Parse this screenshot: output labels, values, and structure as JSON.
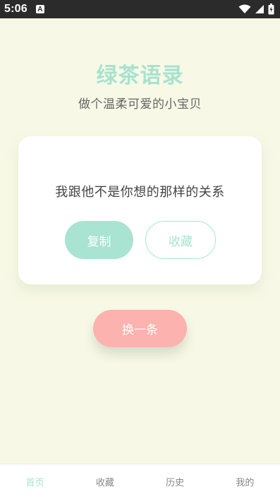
{
  "status_bar": {
    "time": "5:06",
    "badge": "A",
    "icons": [
      "wifi-icon",
      "signal-icon",
      "battery-icon"
    ]
  },
  "header": {
    "title": "绿茶语录",
    "subtitle": "做个温柔可爱的小宝贝"
  },
  "card": {
    "quote": "我跟他不是你想的那样的关系",
    "copy_label": "复制",
    "favorite_label": "收藏"
  },
  "actions": {
    "next_label": "换一条"
  },
  "tab_bar": {
    "tabs": [
      {
        "label": "首页",
        "active": true
      },
      {
        "label": "收藏",
        "active": false
      },
      {
        "label": "历史",
        "active": false
      },
      {
        "label": "我的",
        "active": false
      }
    ]
  },
  "colors": {
    "background": "#f7f9e6",
    "accent_mint": "#a9e3d1",
    "accent_pink": "#fcb2ae",
    "status_bar": "#2b2b2b"
  }
}
